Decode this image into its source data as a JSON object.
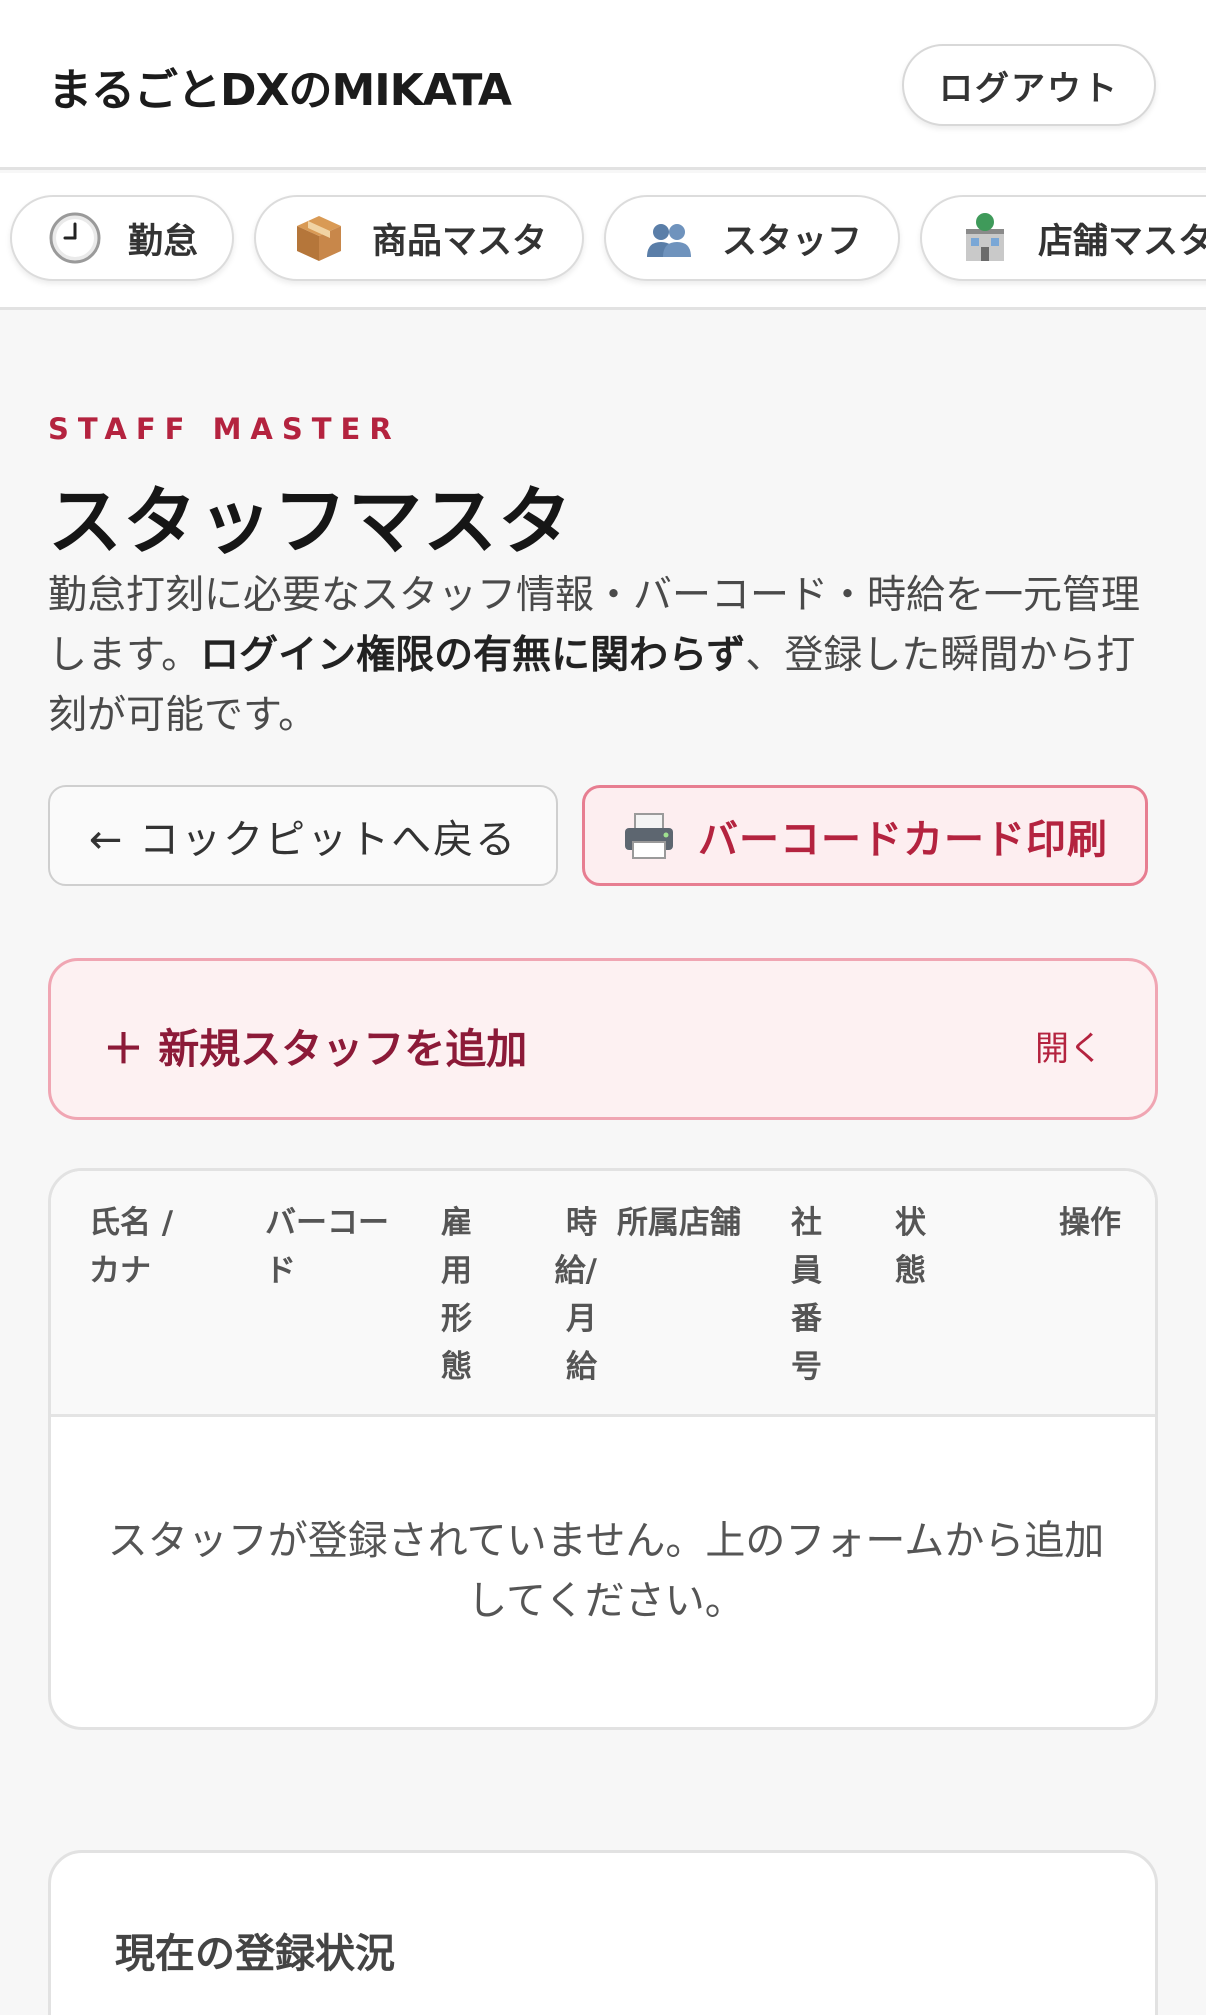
{
  "header": {
    "app_title": "まるごとDXのMIKATA",
    "logout_label": "ログアウト"
  },
  "nav": {
    "items": [
      {
        "label": "勤怠",
        "icon": "clock-icon"
      },
      {
        "label": "商品マスタ",
        "icon": "package-icon"
      },
      {
        "label": "スタッフ",
        "icon": "people-icon"
      },
      {
        "label": "店舗マスタ",
        "icon": "store-icon"
      }
    ]
  },
  "main": {
    "eyebrow": "STAFF MASTER",
    "title": "スタッフマスタ",
    "desc_lead": "勤怠打刻に必要なスタッフ情報・バーコード・時給を一元管理します。",
    "desc_bold": "ログイン権限の有無に関わらず",
    "desc_tail": "、登録した瞬間から打刻が可能です。",
    "back_button": "← コックピットへ戻る",
    "print_button": "バーコードカード印刷",
    "add_panel": {
      "label": "＋ 新規スタッフを追加",
      "toggle": "開く"
    },
    "table": {
      "columns": [
        "氏名 / カナ",
        "バーコード",
        "雇用形態",
        "時給/月給",
        "所属店舗",
        "社員番号",
        "状態",
        "操作"
      ],
      "empty_message": "スタッフが登録されていません。上のフォームから追加してください。"
    },
    "status_section": {
      "title": "現在の登録状況"
    }
  },
  "colors": {
    "accent": "#b4233f",
    "accent_dark": "#8c1a38",
    "accent_bg": "#fdeef0",
    "accent_border": "#e77e91"
  }
}
